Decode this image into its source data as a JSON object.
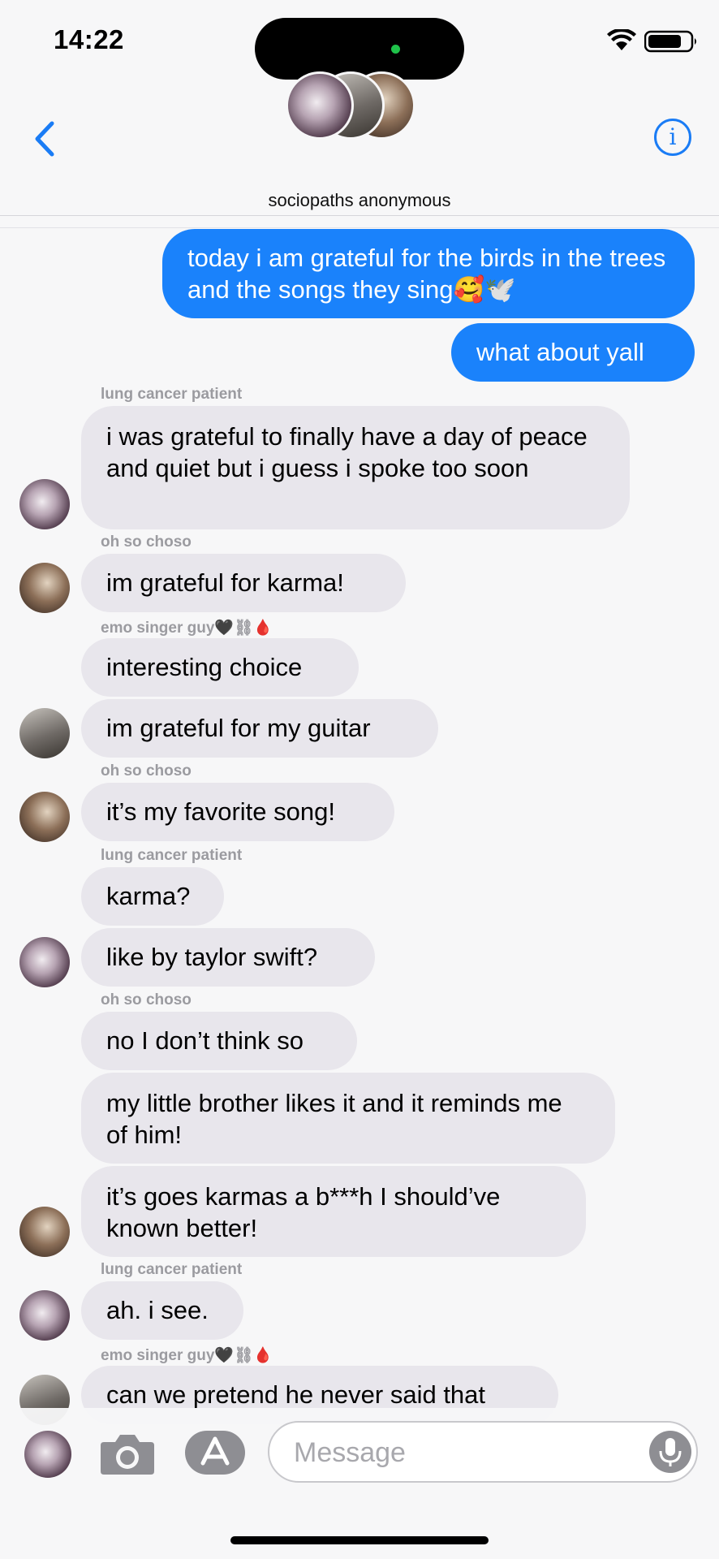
{
  "status": {
    "time": "14:22"
  },
  "header": {
    "group_name": "sociopaths anonymous",
    "info_icon_text": "i"
  },
  "messages": [
    {
      "side": "out",
      "text": "today i am grateful for the birds in the trees and the songs they sing🥰🕊️"
    },
    {
      "side": "out",
      "text": "what about yall"
    },
    {
      "sender": "lung cancer patient"
    },
    {
      "side": "in",
      "text": "i was grateful to finally have a day of peace and quiet but i guess i spoke too soon"
    },
    {
      "sender": "oh so choso"
    },
    {
      "side": "in",
      "text": "im grateful for karma!"
    },
    {
      "sender": "emo singer guy🖤⛓🩸"
    },
    {
      "side": "in",
      "text": "interesting choice"
    },
    {
      "side": "in",
      "text": "im grateful for my guitar"
    },
    {
      "sender": "oh so choso"
    },
    {
      "side": "in",
      "text": "it’s my favorite song!"
    },
    {
      "sender": "lung cancer patient"
    },
    {
      "side": "in",
      "text": "karma?"
    },
    {
      "side": "in",
      "text": "like by taylor swift?"
    },
    {
      "sender": "oh so choso"
    },
    {
      "side": "in",
      "text": "no I don’t think so"
    },
    {
      "side": "in",
      "text": "my little brother likes it and it reminds me of him!"
    },
    {
      "side": "in",
      "text": "it’s goes karmas a b***h I should’ve known better!"
    },
    {
      "sender": "lung cancer patient"
    },
    {
      "side": "in",
      "text": "ah. i see."
    },
    {
      "sender": "emo singer guy🖤⛓🩸"
    },
    {
      "side": "in",
      "text": "can we pretend he never said that"
    }
  ],
  "composer": {
    "placeholder": "Message"
  },
  "colors": {
    "outgoing": "#1a82fb",
    "incoming": "#e8e6ec",
    "accent": "#1a7cf5"
  },
  "icons": [
    "back-chevron-icon",
    "info-icon",
    "camera-icon",
    "app-store-icon",
    "mic-icon",
    "wifi-icon",
    "battery-icon"
  ]
}
